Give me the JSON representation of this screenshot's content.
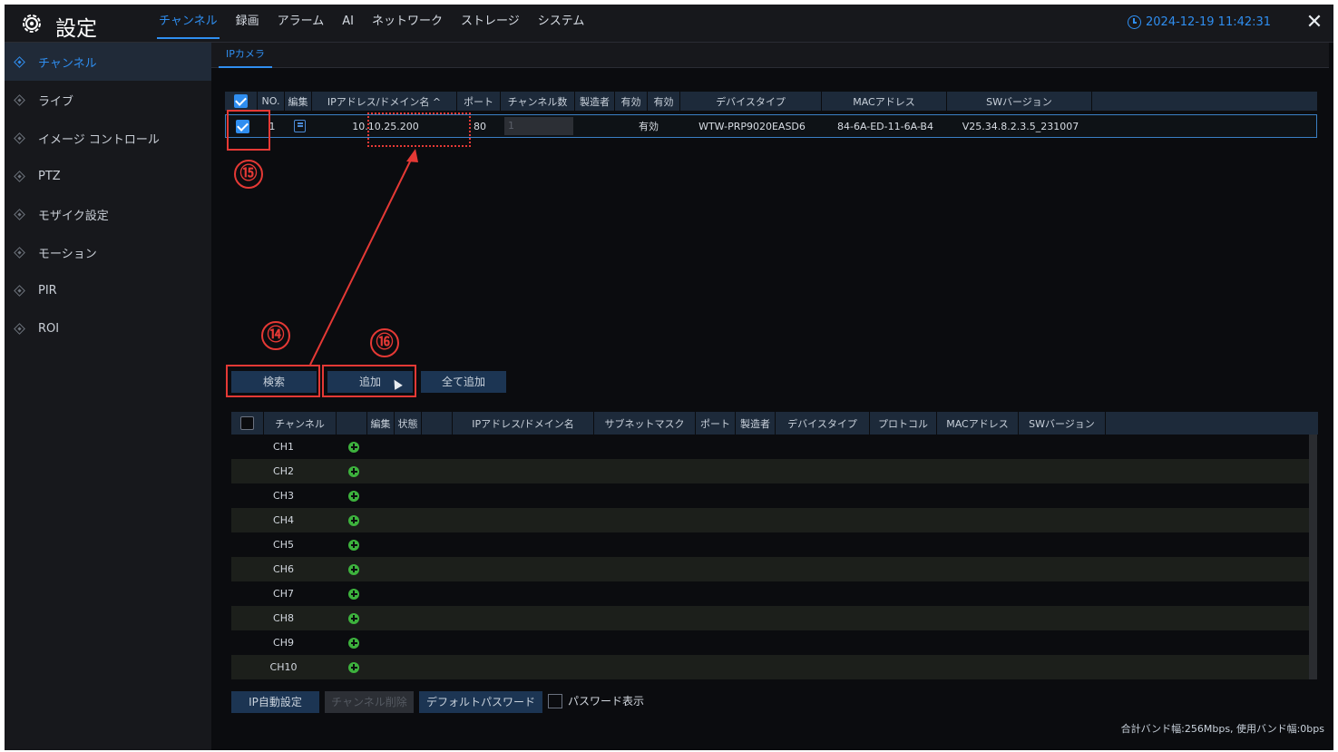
{
  "header": {
    "title": "設定",
    "tabs": [
      "チャンネル",
      "録画",
      "アラーム",
      "AI",
      "ネットワーク",
      "ストレージ",
      "システム"
    ],
    "datetime": "2024-12-19 11:42:31",
    "accent": "#2f8ef0"
  },
  "sidebar": {
    "items": [
      "チャンネル",
      "ライブ",
      "イメージ コントロール",
      "PTZ",
      "モザイク設定",
      "モーション",
      "PIR",
      "ROI"
    ]
  },
  "subtab": {
    "label": "IPカメラ"
  },
  "added_table": {
    "headers": [
      "NO.",
      "編集",
      "IPアドレス/ドメイン名 ^",
      "ポート",
      "チャンネル数",
      "製造者",
      "有効",
      "有効",
      "デバイスタイプ",
      "MACアドレス",
      "SWバージョン"
    ],
    "rows": [
      {
        "no": "1",
        "ip": "10.10.25.200",
        "port": "80",
        "channel": "1",
        "maker": "",
        "enabled": "有効",
        "device": "WTW-PRP9020EASD6",
        "mac": "84-6A-ED-11-6A-B4",
        "sw": "V25.34.8.2.3.5_231007"
      }
    ]
  },
  "buttons": {
    "search": "検索",
    "add": "追加",
    "add_all": "全て追加"
  },
  "channel_table": {
    "headers": [
      "チャンネル",
      "編集",
      "状態",
      "IPアドレス/ドメイン名",
      "サブネットマスク",
      "ポート",
      "製造者",
      "デバイスタイプ",
      "プロトコル",
      "MACアドレス",
      "SWバージョン"
    ],
    "rows": [
      "CH1",
      "CH2",
      "CH3",
      "CH4",
      "CH5",
      "CH6",
      "CH7",
      "CH8",
      "CH9",
      "CH10"
    ]
  },
  "footer": {
    "ip_auto": "IP自動設定",
    "delete_channel": "チャンネル削除",
    "default_password": "デフォルトパスワード",
    "show_password": "パスワード表示",
    "bandwidth": "合計バンド幅:256Mbps, 使用バンド幅:0bps"
  },
  "annotations": {
    "n14": "⑭",
    "n15": "⑮",
    "n16": "⑯"
  }
}
